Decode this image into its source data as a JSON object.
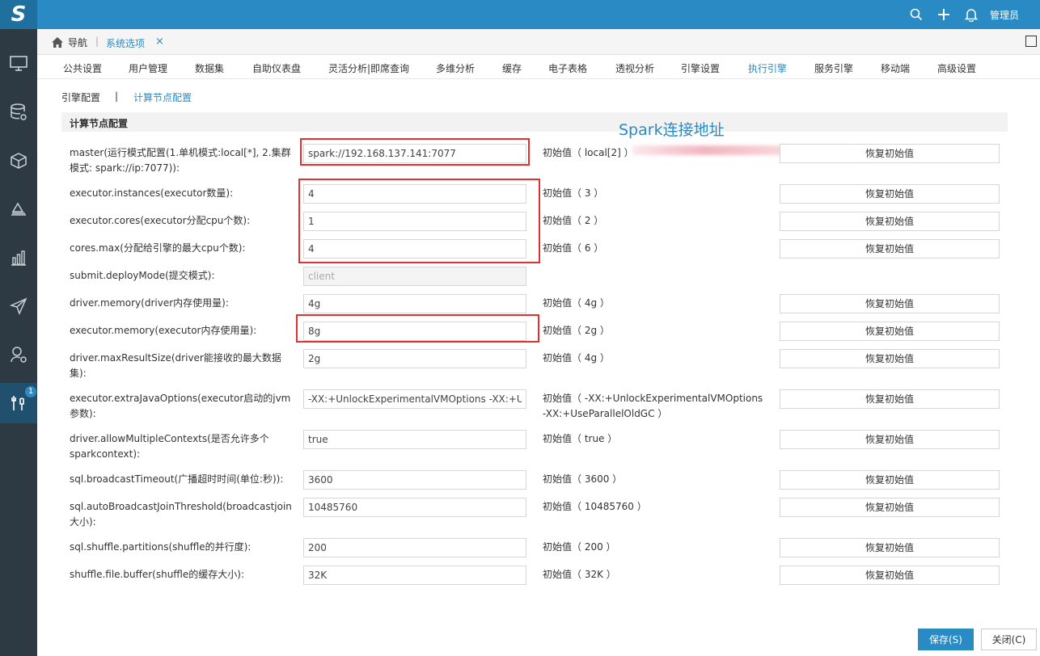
{
  "logo": "S",
  "header": {
    "user": "管理员",
    "icons": [
      "search-icon",
      "plus-icon",
      "bell-icon",
      "chevron-down-icon"
    ]
  },
  "sidebar": {
    "icons": [
      "monitor-icon",
      "database-icon",
      "cube-icon",
      "layers-icon",
      "bar-chart-icon",
      "send-icon",
      "user-settings-icon",
      "tools-icon"
    ],
    "badge": "1"
  },
  "breadcrumb": {
    "home": "导航",
    "separator": "|",
    "tab": "系统选项",
    "close": "×"
  },
  "tabs": [
    {
      "label": "公共设置"
    },
    {
      "label": "用户管理"
    },
    {
      "label": "数据集"
    },
    {
      "label": "自助仪表盘"
    },
    {
      "label": "灵活分析|即席查询"
    },
    {
      "label": "多维分析"
    },
    {
      "label": "缓存"
    },
    {
      "label": "电子表格"
    },
    {
      "label": "透视分析"
    },
    {
      "label": "引擎设置"
    },
    {
      "label": "执行引擎"
    },
    {
      "label": "服务引擎"
    },
    {
      "label": "移动端"
    },
    {
      "label": "高级设置"
    }
  ],
  "subtabs": {
    "engine_config": "引擎配置",
    "separator": "|",
    "compute_node": "计算节点配置"
  },
  "section_title": "计算节点配置",
  "annotation": "Spark连接地址",
  "restore_label": "恢复初始值",
  "rows": [
    {
      "label": "master(运行模式配置(1.单机模式:local[*], 2.集群模式: spark://ip:7077)):",
      "value": "spark://192.168.137.141:7077",
      "initial": "初始值（ local[2] ）"
    },
    {
      "label": "executor.instances(executor数量):",
      "value": "4",
      "initial": "初始值（ 3 ）"
    },
    {
      "label": "executor.cores(executor分配cpu个数):",
      "value": "1",
      "initial": "初始值（ 2 ）"
    },
    {
      "label": "cores.max(分配给引擎的最大cpu个数):",
      "value": "4",
      "initial": "初始值（ 6 ）"
    },
    {
      "label": "submit.deployMode(提交模式):",
      "value": "client",
      "initial": ""
    },
    {
      "label": "driver.memory(driver内存使用量):",
      "value": "4g",
      "initial": "初始值（ 4g ）"
    },
    {
      "label": "executor.memory(executor内存使用量):",
      "value": "8g",
      "initial": "初始值（ 2g ）"
    },
    {
      "label": "driver.maxResultSize(driver能接收的最大数据集):",
      "value": "2g",
      "initial": "初始值（ 4g ）"
    },
    {
      "label": "executor.extraJavaOptions(executor启动的jvm参数):",
      "value": "-XX:+UnlockExperimentalVMOptions -XX:+UseParallelOldGC",
      "initial": "初始值（ -XX:+UnlockExperimentalVMOptions -XX:+UseParallelOldGC ）"
    },
    {
      "label": "driver.allowMultipleContexts(是否允许多个sparkcontext):",
      "value": "true",
      "initial": "初始值（ true ）"
    },
    {
      "label": "sql.broadcastTimeout(广播超时时间(单位:秒)):",
      "value": "3600",
      "initial": "初始值（ 3600 ）"
    },
    {
      "label": "sql.autoBroadcastJoinThreshold(broadcastjoin大小):",
      "value": "10485760",
      "initial": "初始值（ 10485760 ）"
    },
    {
      "label": "sql.shuffle.partitions(shuffle的并行度):",
      "value": "200",
      "initial": "初始值（ 200 ）"
    },
    {
      "label": "shuffle.file.buffer(shuffle的缓存大小):",
      "value": "32K",
      "initial": "初始值（ 32K ）"
    }
  ],
  "footer": {
    "save": "保存(S)",
    "close": "关闭(C)"
  }
}
